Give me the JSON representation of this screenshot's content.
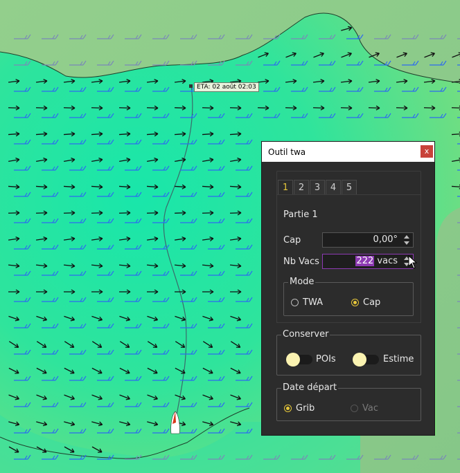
{
  "map": {
    "eta_label": "ETA: 02 août 02:03",
    "colors": {
      "sea": "#1fe6a8",
      "sea_light": "#6fe08a",
      "land": "#8cc98a",
      "coast": "#1e3d2a",
      "route": "#3a6a6a"
    },
    "arrow_icon": "wind-arrow-icon",
    "barb_icon": "wind-barb-icon",
    "boat_icon": "boat-icon"
  },
  "dialog": {
    "title": "Outil twa",
    "close_label": "x",
    "tabs": [
      "1",
      "2",
      "3",
      "4",
      "5"
    ],
    "active_tab": 0,
    "part_title": "Partie 1",
    "cap": {
      "label": "Cap",
      "value": "0,00°"
    },
    "nb_vacs": {
      "label": "Nb Vacs",
      "value_selected": "222",
      "value_suffix": " vacs"
    },
    "mode": {
      "title": "Mode",
      "options": [
        {
          "label": "TWA",
          "checked": false
        },
        {
          "label": "Cap",
          "checked": true
        }
      ]
    },
    "conserver": {
      "title": "Conserver",
      "toggles": [
        {
          "label": "POIs",
          "on": false
        },
        {
          "label": "Estime",
          "on": false
        }
      ]
    },
    "date_depart": {
      "title": "Date départ",
      "options": [
        {
          "label": "Grib",
          "checked": true,
          "enabled": true
        },
        {
          "label": "Vac",
          "checked": false,
          "enabled": false
        }
      ]
    },
    "accent_color": "#e6c73a",
    "focus_color": "#8d3ab3"
  }
}
